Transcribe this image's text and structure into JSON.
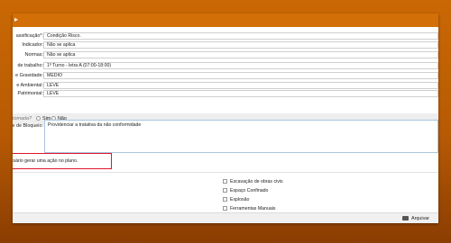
{
  "form": {
    "fields": [
      {
        "label": "assificação*:",
        "value": "Condição Risco."
      },
      {
        "label": "Indicador:",
        "value": "Não se aplica"
      },
      {
        "label": "Normas:",
        "value": "Não se aplica"
      },
      {
        "label": "de trabalho:",
        "value": "1º Turno - letra A (07:00-18:00)"
      },
      {
        "label": "e Gravidade:",
        "value": "MÉDIO"
      },
      {
        "label": "e Ambiental:",
        "value": "LEVE"
      },
      {
        "label": "Patrimonial:",
        "value": "LEVE"
      }
    ],
    "radio_question": "tomada?",
    "radio_yes": "Sim",
    "radio_no": "Não",
    "bloqueio_label": "e de Bloqueio:",
    "bloqueio_value": "Providenciar a tratativa da não conformidade",
    "alert_text": "essário gerar uma ação no plano."
  },
  "checklist": [
    "Escavação de obras civis",
    "Espaço Confinado",
    "Explosão",
    "Ferramentas Manuais"
  ],
  "footer": {
    "archive_label": "Arquivar"
  },
  "colors": {
    "accent": "#d26f06",
    "alert_border": "#e0152c"
  }
}
